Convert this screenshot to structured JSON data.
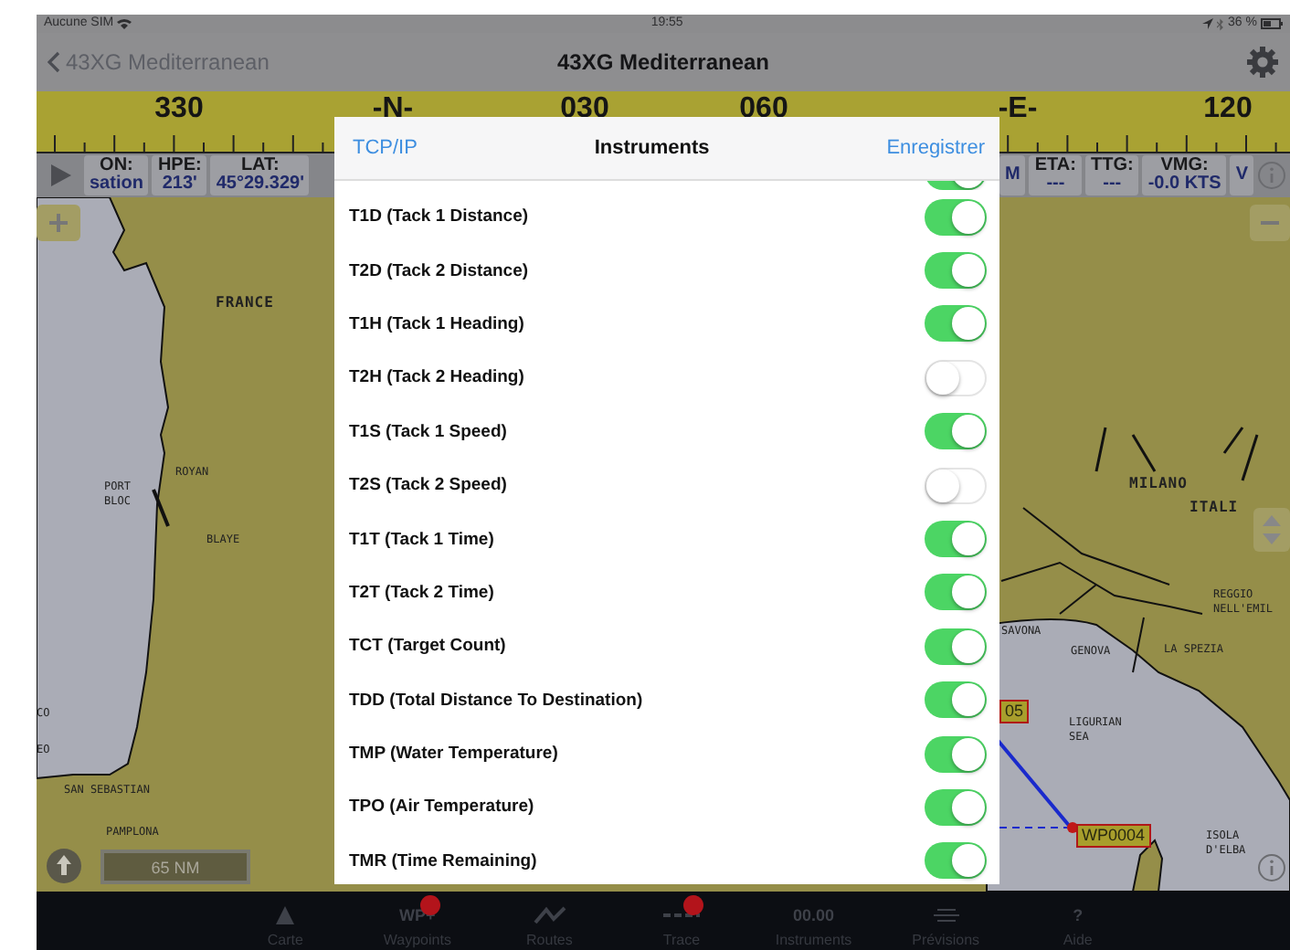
{
  "status_bar": {
    "carrier": "Aucune SIM",
    "time": "19:55",
    "battery": "36 %"
  },
  "nav": {
    "back": "43XG Mediterranean",
    "title": "43XG Mediterranean"
  },
  "compass": {
    "labels": [
      "330",
      "-N-",
      "030",
      "060",
      "-E-",
      "120"
    ]
  },
  "instruments_bar": {
    "left": [
      {
        "label": "ON:",
        "value": "sation"
      },
      {
        "label": "HPE:",
        "value": "213'"
      },
      {
        "label": "LAT:",
        "value": "45°29.329'"
      }
    ],
    "right": [
      {
        "value": "M"
      },
      {
        "label": "ETA:",
        "value": "---"
      },
      {
        "label": "TTG:",
        "value": "---"
      },
      {
        "label": "VMG:",
        "value": "-0.0 KTS"
      },
      {
        "value": "V"
      }
    ]
  },
  "map": {
    "labels": [
      {
        "text": "FRANCE",
        "kind": "country"
      },
      {
        "text": "ROYAN",
        "kind": "place"
      },
      {
        "text": "PORT BLOC",
        "kind": "place"
      },
      {
        "text": "BLAYE",
        "kind": "place"
      },
      {
        "text": "CO",
        "kind": "place"
      },
      {
        "text": "EO",
        "kind": "place"
      },
      {
        "text": "SAN SEBASTIAN",
        "kind": "place"
      },
      {
        "text": "PAMPLONA",
        "kind": "place"
      },
      {
        "text": "MILANO",
        "kind": "country"
      },
      {
        "text": "ITALI",
        "kind": "country"
      },
      {
        "text": "REGGIO NELL'EMIL",
        "kind": "place"
      },
      {
        "text": "SAVONA",
        "kind": "place"
      },
      {
        "text": "GENOVA",
        "kind": "place"
      },
      {
        "text": "LA SPEZIA",
        "kind": "place"
      },
      {
        "text": "LIGURIAN SEA",
        "kind": "place"
      },
      {
        "text": "ISOLA D'ELBA",
        "kind": "place"
      },
      {
        "text": "05",
        "kind": "waypoint"
      },
      {
        "text": "WP0004",
        "kind": "waypoint"
      }
    ],
    "scale": "65 NM"
  },
  "dialog": {
    "left_button": "TCP/IP",
    "title": "Instruments",
    "right_button": "Enregistrer",
    "rows": [
      {
        "on": true
      },
      {
        "label": "T1D (Tack 1 Distance)",
        "on": true
      },
      {
        "label": "T2D (Tack 2 Distance)",
        "on": true
      },
      {
        "label": "T1H (Tack 1 Heading)",
        "on": true
      },
      {
        "label": "T2H (Tack 2 Heading)",
        "on": false
      },
      {
        "label": "T1S (Tack 1 Speed)",
        "on": true
      },
      {
        "label": "T2S (Tack 2 Speed)",
        "on": false
      },
      {
        "label": "T1T (Tack 1 Time)",
        "on": true
      },
      {
        "label": "T2T (Tack 2 Time)",
        "on": true
      },
      {
        "label": "TCT (Target Count)",
        "on": true
      },
      {
        "label": "TDD (Total Distance To Destination)",
        "on": true
      },
      {
        "label": "TMP (Water Temperature)",
        "on": true
      },
      {
        "label": "TPO (Air Temperature)",
        "on": true
      },
      {
        "label": "TMR (Time Remaining)",
        "on": true
      }
    ]
  },
  "tab_bar": [
    {
      "kind": "chart",
      "label": "Carte",
      "badge": false
    },
    {
      "kind": "waypoint",
      "icon_text": "WP+",
      "label": "Waypoints",
      "badge": true
    },
    {
      "kind": "route",
      "label": "Routes",
      "badge": false
    },
    {
      "kind": "trace",
      "label": "Trace",
      "badge": true
    },
    {
      "kind": "digits",
      "icon_text": "00.00",
      "label": "Instruments",
      "badge": false
    },
    {
      "kind": "forecast",
      "label": "Prévisions",
      "badge": false
    },
    {
      "kind": "help",
      "icon_text": "?",
      "label": "Aide",
      "badge": false
    }
  ]
}
